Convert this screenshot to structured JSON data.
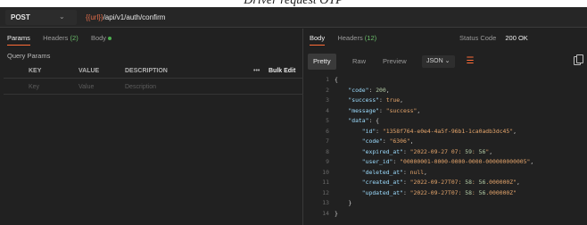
{
  "caption": "Driver request OTP",
  "request": {
    "method": "POST",
    "url_variable": "{{url}}",
    "url_path": "/api/v1/auth/confirm"
  },
  "request_tabs": [
    {
      "label": "Params",
      "active": true
    },
    {
      "label": "Headers",
      "count": "(2)"
    },
    {
      "label": "Body"
    }
  ],
  "query_params": {
    "title": "Query Params",
    "columns": [
      "KEY",
      "VALUE",
      "DESCRIPTION"
    ],
    "more": "•••",
    "bulk_edit": "Bulk Edit",
    "placeholders": {
      "key": "Key",
      "value": "Value",
      "description": "Description"
    }
  },
  "response_tabs": [
    {
      "label": "Body",
      "active": true
    },
    {
      "label": "Headers",
      "count": "(12)"
    }
  ],
  "status": {
    "label": "Status Code",
    "value": "200 OK"
  },
  "viewer": {
    "modes": [
      "Pretty",
      "Raw",
      "Preview"
    ],
    "format": "JSON",
    "format_chevron": "⌄"
  },
  "response_lines": [
    {
      "n": "1",
      "text": "{"
    },
    {
      "n": "2",
      "text": "    \"code\": 200,"
    },
    {
      "n": "3",
      "text": "    \"success\": true,"
    },
    {
      "n": "4",
      "text": "    \"message\": \"success\","
    },
    {
      "n": "5",
      "text": "    \"data\": {"
    },
    {
      "n": "6",
      "text": "        \"id\": \"1358f764-e0e4-4a5f-96b1-1ca0adb3dc45\","
    },
    {
      "n": "7",
      "text": "        \"code\": \"6306\","
    },
    {
      "n": "8",
      "text": "        \"expired_at\": \"2022-09-27 07:59:56\","
    },
    {
      "n": "9",
      "text": "        \"user_id\": \"00000001-0000-0000-0000-000000000005\","
    },
    {
      "n": "10",
      "text": "        \"deleted_at\": null,"
    },
    {
      "n": "11",
      "text": "        \"created_at\": \"2022-09-27T07:58:56.000000Z\","
    },
    {
      "n": "12",
      "text": "        \"updated_at\": \"2022-09-27T07:58:56.000000Z\""
    },
    {
      "n": "13",
      "text": "    }"
    },
    {
      "n": "14",
      "text": "}"
    }
  ],
  "colors": {
    "accent": "#ff6c37",
    "url_variable": "#e06c4a",
    "success": "#4caf50"
  }
}
